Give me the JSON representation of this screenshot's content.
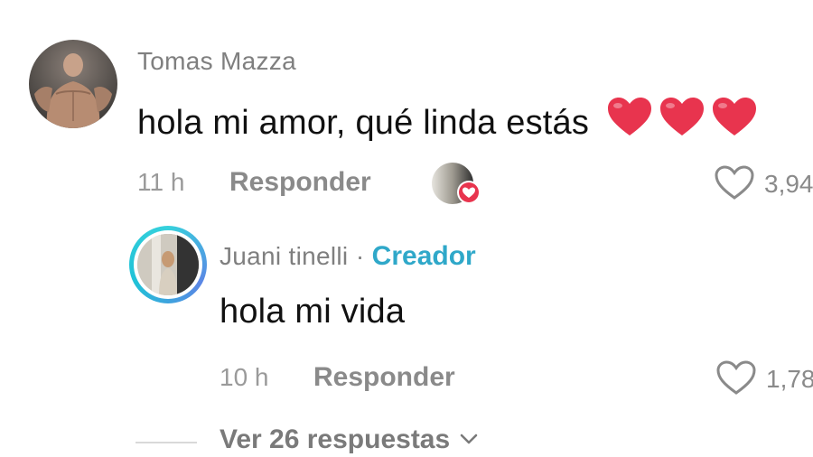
{
  "comment": {
    "username": "Tomas Mazza",
    "text": "hola mi amor, qué linda estás",
    "emoji": "❤️❤️❤️",
    "time": "11 h",
    "reply_label": "Responder",
    "like_count": "3,94"
  },
  "reply": {
    "username": "Juani tinelli",
    "separator": "·",
    "creator_tag": "Creador",
    "text": "hola mi vida",
    "time": "10 h",
    "reply_label": "Responder",
    "like_count": "1,78"
  },
  "view_replies": {
    "label": "Ver 26 respuestas"
  },
  "colors": {
    "creator": "#2fa8c9",
    "heart": "#e8344e",
    "ring": "#36d1dc"
  }
}
